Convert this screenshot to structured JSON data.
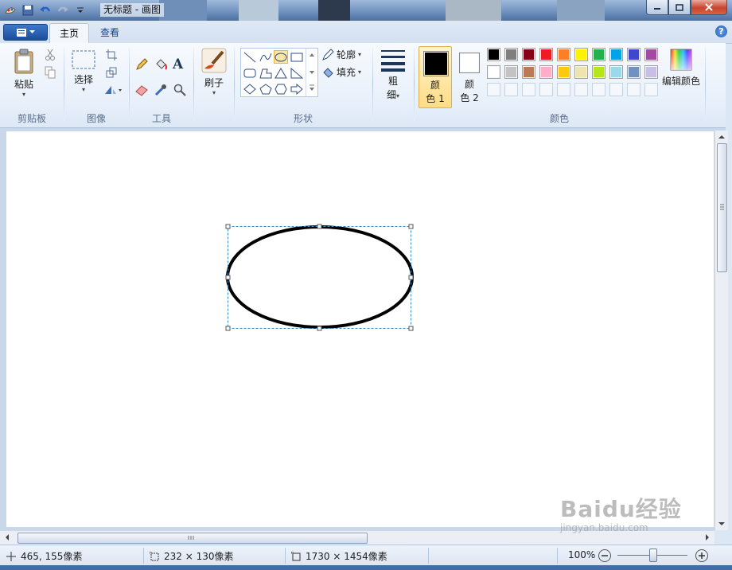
{
  "window": {
    "title": "无标题 - 画图"
  },
  "tabs": {
    "home": "主页",
    "view": "查看"
  },
  "help": "?",
  "ribbon": {
    "clipboard": {
      "paste": "粘贴",
      "label": "剪贴板"
    },
    "image": {
      "select": "选择",
      "label": "图像"
    },
    "tools": {
      "text_glyph": "A",
      "label": "工具"
    },
    "brushes": {
      "label": "刷子"
    },
    "shapes": {
      "outline": "轮廓",
      "fill": "填充",
      "label": "形状"
    },
    "size": {
      "label_top": "粗",
      "label_bottom": "细"
    },
    "colors": {
      "color1_top": "颜",
      "color1_bottom": "色 1",
      "color2_top": "颜",
      "color2_bottom": "色 2",
      "edit": "编辑颜色",
      "label": "颜色",
      "color1_value": "#000000",
      "color2_value": "#ffffff",
      "palette_row1": [
        "#000000",
        "#7f7f7f",
        "#880015",
        "#ed1c24",
        "#ff7f27",
        "#fff200",
        "#22b14c",
        "#00a2e8",
        "#3f48cc",
        "#a349a4"
      ],
      "palette_row2": [
        "#ffffff",
        "#c3c3c3",
        "#b97a57",
        "#ffaec9",
        "#ffc90e",
        "#efe4b0",
        "#b5e61d",
        "#99d9ea",
        "#7092be",
        "#c8bfe7"
      ]
    }
  },
  "status": {
    "cursor": "465, 155像素",
    "selection": "232 × 130像素",
    "image_size": "1730 × 1454像素",
    "zoom": "100%"
  },
  "watermark": {
    "brand": "Baidu经验",
    "url": "jingyan.baidu.com"
  }
}
